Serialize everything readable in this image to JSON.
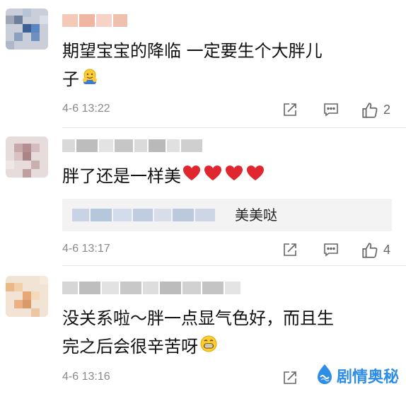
{
  "comments": [
    {
      "text_line1": "期望宝宝的降临 一定要生个大胖儿",
      "text_line2": "子",
      "emoji": "hugging-emoji",
      "time": "4-6 13:22",
      "likes": "2"
    },
    {
      "text": "胖了还是一样美",
      "emoji": "red-heart-emoji x4",
      "reply_text": "美美哒",
      "time": "4-6 13:17",
      "likes": "4"
    },
    {
      "text_line1": "没关系啦～胖一点显气色好，而且生",
      "text_line2": "完之后会很辛苦呀",
      "emoji": "grinning-emoji",
      "time": "4-6 13:16"
    }
  ],
  "watermark": {
    "text": "剧情奥秘",
    "icon": "wave-logo-icon"
  },
  "colors": {
    "accent": "#2e8de6",
    "heart": "#e0262f",
    "meta": "#8a8a8a"
  }
}
